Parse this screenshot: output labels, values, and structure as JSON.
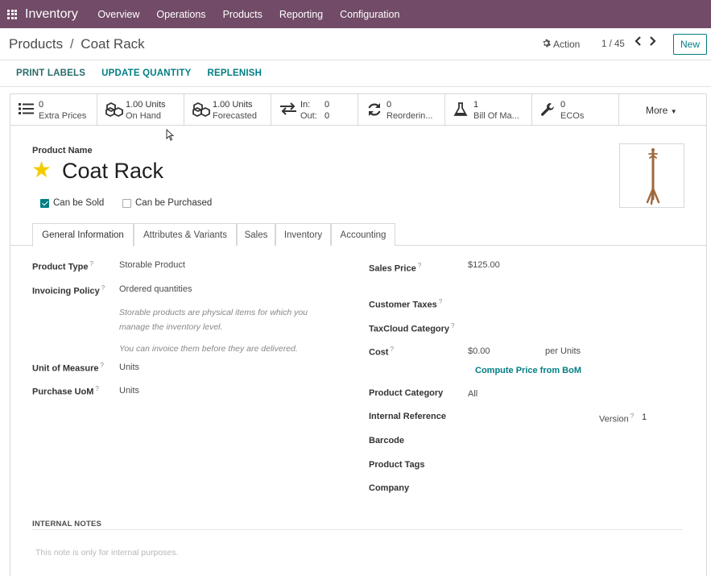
{
  "navbar": {
    "app_name": "Inventory",
    "menu": [
      "Overview",
      "Operations",
      "Products",
      "Reporting",
      "Configuration"
    ]
  },
  "breadcrumb": {
    "parent": "Products",
    "current": "Coat Rack",
    "separator": "/"
  },
  "control": {
    "action_label": "Action",
    "pager": "1 / 45",
    "new_label": "New"
  },
  "header_buttons": [
    "PRINT LABELS",
    "UPDATE QUANTITY",
    "REPLENISH"
  ],
  "stats": {
    "extra_prices": {
      "value": "0",
      "label": "Extra Prices",
      "icon": "list-icon"
    },
    "on_hand": {
      "value": "1.00 Units",
      "label": "On Hand",
      "icon": "cubes-icon"
    },
    "forecasted": {
      "value": "1.00 Units",
      "label": "Forecasted",
      "icon": "cubes-icon"
    },
    "in_out": {
      "in_label": "In:",
      "in_value": "0",
      "out_label": "Out:",
      "out_value": "0",
      "icon": "exchange-icon"
    },
    "reordering": {
      "value": "0",
      "label": "Reorderin...",
      "icon": "refresh-icon"
    },
    "bom": {
      "value": "1",
      "label": "Bill Of Ma...",
      "icon": "flask-icon"
    },
    "ecos": {
      "value": "0",
      "label": "ECOs",
      "icon": "wrench-icon"
    },
    "more_label": "More"
  },
  "product": {
    "name_label": "Product Name",
    "name": "Coat Rack",
    "favorite": true,
    "can_be_sold_label": "Can be Sold",
    "can_be_sold": true,
    "can_be_purchased_label": "Can be Purchased",
    "can_be_purchased": false
  },
  "tabs": [
    "General Information",
    "Attributes & Variants",
    "Sales",
    "Inventory",
    "Accounting"
  ],
  "general": {
    "product_type_label": "Product Type",
    "product_type": "Storable Product",
    "invoicing_policy_label": "Invoicing Policy",
    "invoicing_policy": "Ordered quantities",
    "help_storable_1": "Storable products are physical items for which you",
    "help_storable_2": "manage the inventory level.",
    "help_invoice": "You can invoice them before they are delivered.",
    "uom_label": "Unit of Measure",
    "uom": "Units",
    "purchase_uom_label": "Purchase UoM",
    "purchase_uom": "Units",
    "sales_price_label": "Sales Price",
    "sales_price": "$125.00",
    "customer_taxes_label": "Customer Taxes",
    "taxcloud_label": "TaxCloud Category",
    "cost_label": "Cost",
    "cost": "$0.00",
    "cost_unit": "per Units",
    "compute_price_label": "Compute Price from BoM",
    "category_label": "Product Category",
    "category": "All",
    "internal_ref_label": "Internal Reference",
    "version_label": "Version",
    "version": "1",
    "barcode_label": "Barcode",
    "tags_label": "Product Tags",
    "company_label": "Company",
    "help_mark": "?"
  },
  "notes": {
    "title": "INTERNAL NOTES",
    "placeholder": "This note is only for internal purposes."
  },
  "colors": {
    "navbar": "#714b67",
    "accent": "#017e84",
    "star": "#f3cc00"
  }
}
